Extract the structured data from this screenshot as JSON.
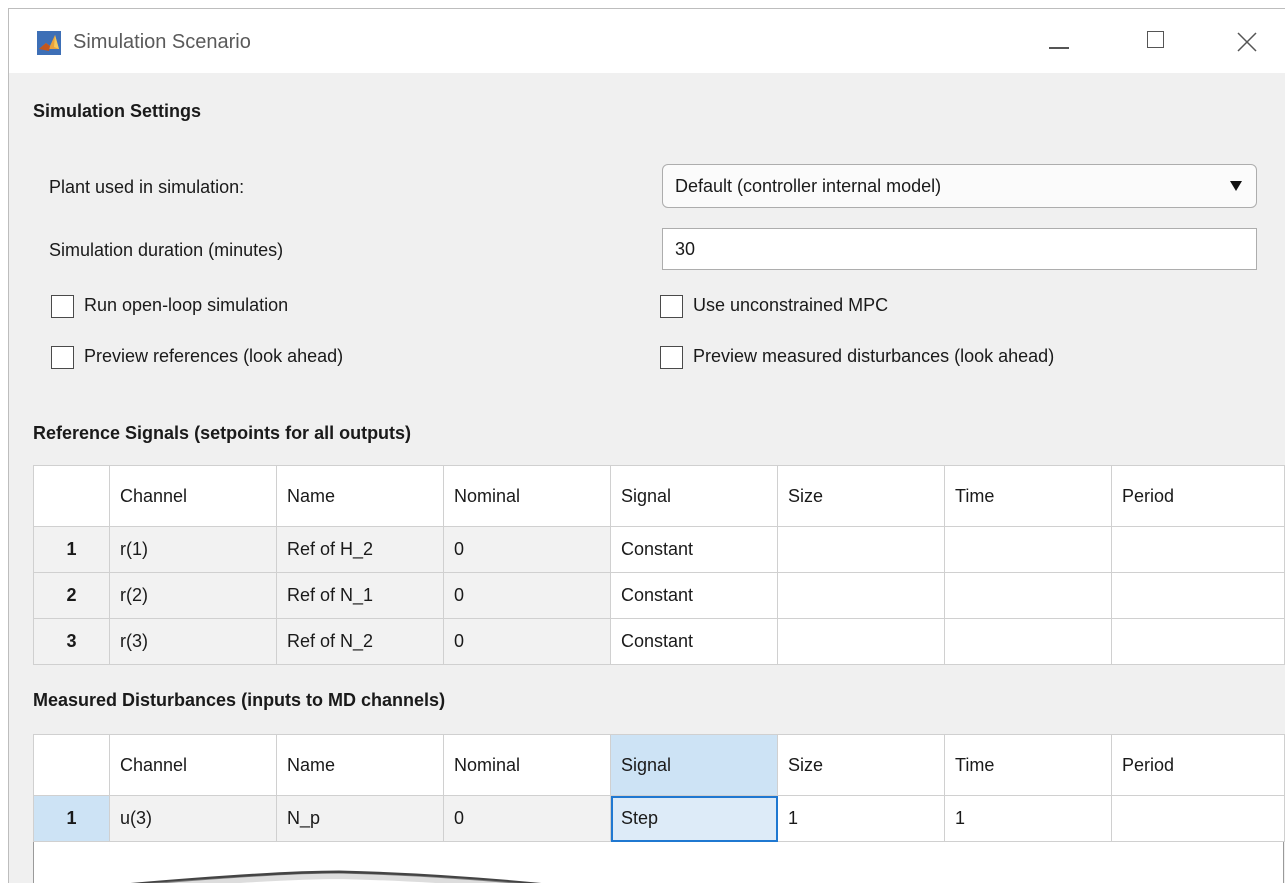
{
  "window": {
    "title": "Simulation Scenario"
  },
  "settings": {
    "heading": "Simulation Settings",
    "plant_label": "Plant used in simulation:",
    "plant_value": "Default (controller internal model)",
    "duration_label": "Simulation duration (minutes)",
    "duration_value": "30",
    "open_loop_label": "Run open-loop simulation",
    "unconstrained_label": "Use unconstrained MPC",
    "preview_refs_label": "Preview references (look ahead)",
    "preview_md_label": "Preview measured disturbances (look ahead)"
  },
  "reference": {
    "heading": "Reference Signals (setpoints for all outputs)",
    "columns": [
      "Channel",
      "Name",
      "Nominal",
      "Signal",
      "Size",
      "Time",
      "Period"
    ],
    "rows": [
      {
        "index": "1",
        "channel": "r(1)",
        "name": "Ref of H_2",
        "nominal": "0",
        "signal": "Constant",
        "size": "",
        "time": "",
        "period": ""
      },
      {
        "index": "2",
        "channel": "r(2)",
        "name": "Ref of N_1",
        "nominal": "0",
        "signal": "Constant",
        "size": "",
        "time": "",
        "period": ""
      },
      {
        "index": "3",
        "channel": "r(3)",
        "name": "Ref of N_2",
        "nominal": "0",
        "signal": "Constant",
        "size": "",
        "time": "",
        "period": ""
      }
    ]
  },
  "disturbance": {
    "heading": "Measured Disturbances (inputs to MD channels)",
    "columns": [
      "Channel",
      "Name",
      "Nominal",
      "Signal",
      "Size",
      "Time",
      "Period"
    ],
    "rows": [
      {
        "index": "1",
        "channel": "u(3)",
        "name": "N_p",
        "nominal": "0",
        "signal": "Step",
        "size": "1",
        "time": "1",
        "period": ""
      }
    ]
  },
  "icons": {
    "app": "matlab-logo-icon",
    "minimize": "minimize-icon",
    "maximize": "maximize-icon",
    "close": "close-icon",
    "dropdown": "chevron-down-icon"
  },
  "colors": {
    "selection": "#cde3f5",
    "selected_cell_border": "#1f78d1",
    "window_bg": "#f0f0f0"
  }
}
